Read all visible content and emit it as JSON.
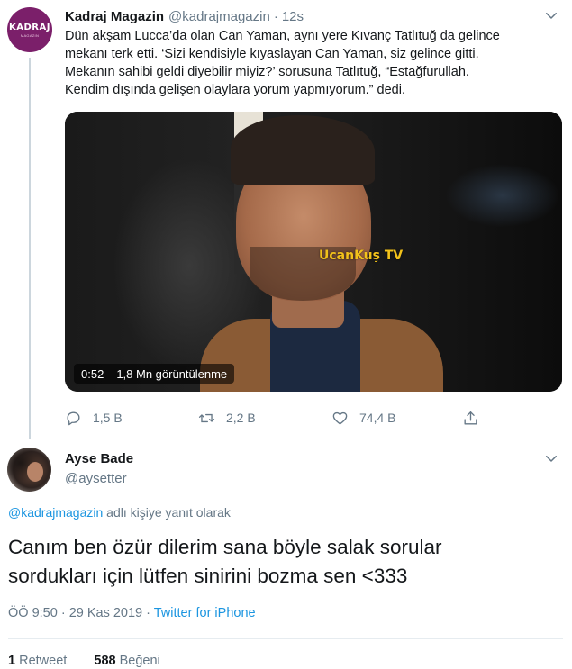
{
  "tweet": {
    "author_name": "Kadraj Magazin",
    "author_handle": "@kadrajmagazin",
    "separator": "·",
    "time": "12s",
    "avatar_logo": "KADRAJ",
    "avatar_logo_sub": "MAGAZIN",
    "text_lines": [
      "Dün akşam Lucca’da olan Can Yaman, aynı yere Kıvanç Tatlıtuğ da gelince",
      "mekanı terk etti. ‘Sizi kendisiyle kıyaslayan Can Yaman, siz gelince gitti.",
      "Mekanın sahibi geldi diyebilir miyiz?’ sorusuna Tatlıtuğ, “Estağfurullah.",
      "Kendim dışında gelişen olaylara yorum yapmıyorum.” dedi."
    ],
    "video": {
      "duration": "0:52",
      "views": "1,8 Mn görüntülenme",
      "watermark": "UcanKuş TV"
    },
    "actions": {
      "replies": "1,5 B",
      "retweets": "2,2 B",
      "likes": "74,4 B"
    }
  },
  "reply": {
    "author_name": "Ayse Bade",
    "author_handle": "@aysetter",
    "replying_mention": "@kadrajmagazin",
    "replying_suffix": " adlı kişiye yanıt olarak",
    "body_lines": [
      "Canım ben özür dilerim sana böyle salak sorular",
      "sordukları için lütfen sinirini bozma sen <333"
    ],
    "timestamp": "ÖÖ 9:50 · 29 Kas 2019 · ",
    "source": "Twitter for iPhone",
    "retweet_count": "1",
    "retweet_label": " Retweet",
    "like_count": "588",
    "like_label": " Beğeni"
  },
  "icons": [
    "chevron-down-icon",
    "reply-icon",
    "retweet-icon",
    "like-icon",
    "share-icon"
  ],
  "colors": {
    "text": "#14171a",
    "secondary": "#657786",
    "link": "#1b95e0",
    "avatar_brand": "#7b1f6a",
    "divider": "#e6ecf0"
  }
}
